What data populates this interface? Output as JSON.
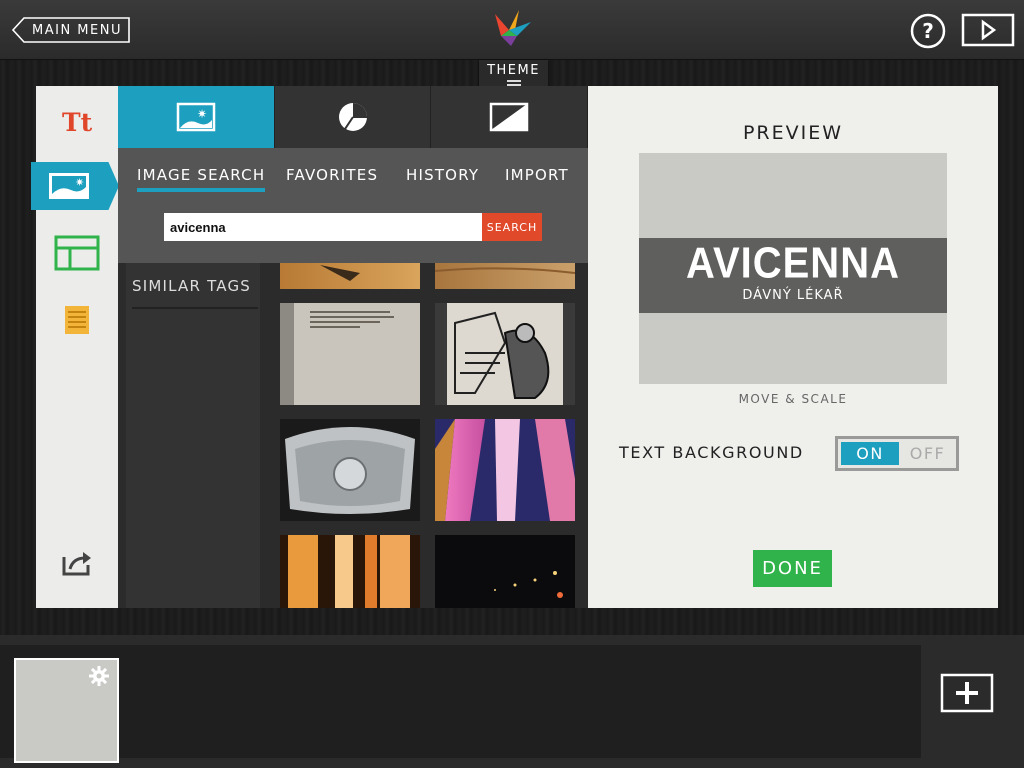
{
  "topbar": {
    "main_menu_label": "MAIN MENU"
  },
  "theme": {
    "label": "THEME"
  },
  "panel": {
    "subtabs": [
      "IMAGE SEARCH",
      "FAVORITES",
      "HISTORY",
      "IMPORT"
    ],
    "search": {
      "value": "avicenna",
      "button_label": "SEARCH"
    },
    "similar_tags_label": "SIMILAR TAGS"
  },
  "preview": {
    "title": "PREVIEW",
    "main_text": "AVICENNA",
    "sub_text": "DÁVNÝ LÉKAŘ",
    "move_scale_label": "MOVE & SCALE",
    "text_background_label": "TEXT BACKGROUND",
    "toggle_on": "ON",
    "toggle_off": "OFF",
    "done_label": "DONE"
  },
  "colors": {
    "accent": "#1d9fbf",
    "search_button": "#e04a2a",
    "done": "#2fb34a"
  }
}
